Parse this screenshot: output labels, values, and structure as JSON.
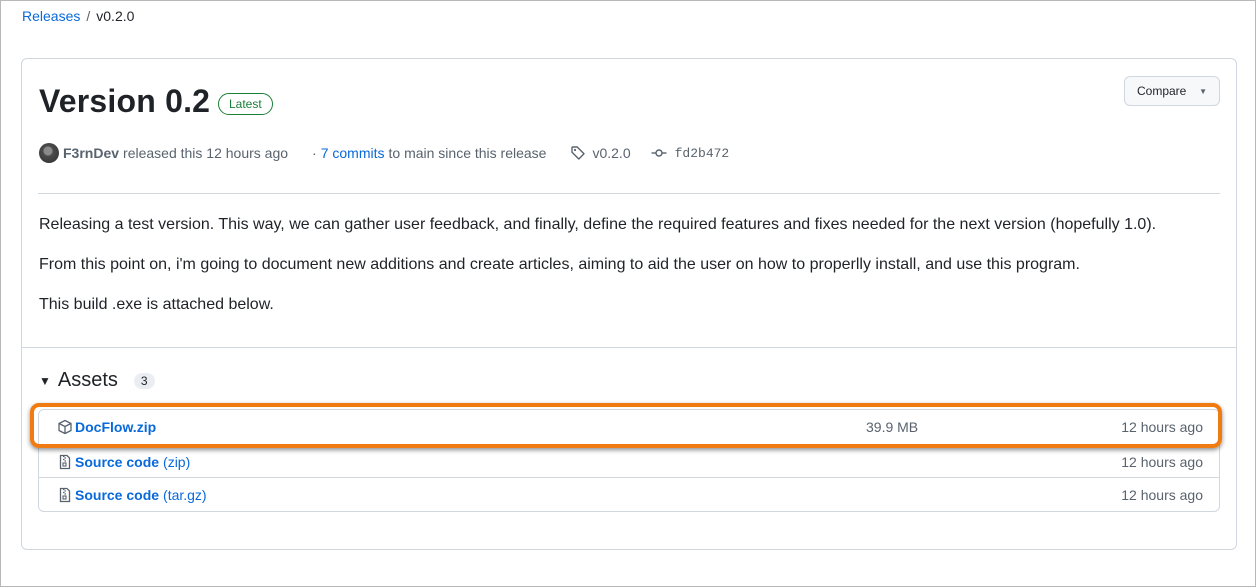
{
  "breadcrumb": {
    "root": "Releases",
    "separator": "/",
    "current": "v0.2.0"
  },
  "release": {
    "title": "Version 0.2",
    "badge": "Latest",
    "compare_label": "Compare",
    "author": "F3rnDev",
    "released_text": "released this 12 hours ago",
    "commits_prefix": "·",
    "commits_link": "7 commits",
    "commits_suffix": "to main since this release",
    "tag": "v0.2.0",
    "commit_sha": "fd2b472"
  },
  "body": {
    "paragraphs": [
      "Releasing a test version. This way, we can gather user feedback, and finally, define the required features and fixes needed for the next version (hopefully 1.0).",
      "From this point on, i'm going to document new additions and create articles, aiming to aid the user on how to properlly install, and use this program.",
      "This build .exe is attached below."
    ]
  },
  "assets": {
    "heading": "Assets",
    "count": "3",
    "items": [
      {
        "name": "DocFlow.zip",
        "format": "",
        "size": "39.9 MB",
        "time": "12 hours ago",
        "icon": "package-icon"
      },
      {
        "name": "Source code",
        "format": "(zip)",
        "size": "",
        "time": "12 hours ago",
        "icon": "file-zip-icon"
      },
      {
        "name": "Source code",
        "format": "(tar.gz)",
        "size": "",
        "time": "12 hours ago",
        "icon": "file-zip-icon"
      }
    ]
  },
  "colors": {
    "link": "#0969da",
    "latest": "#1a7f37",
    "highlight": "#f07b12"
  }
}
